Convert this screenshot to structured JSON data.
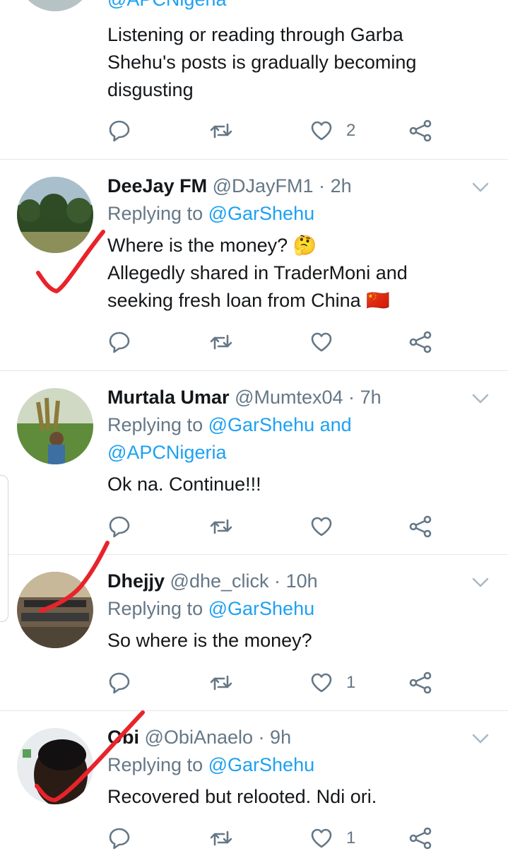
{
  "tweets": [
    {
      "reply_to_links": [
        "@APCNigeria"
      ],
      "text": [
        "Listening or reading through Garba",
        "Shehu's posts is gradually becoming",
        "disgusting"
      ],
      "likes": "2"
    },
    {
      "name": "DeeJay FM",
      "handle": "@DJayFM1",
      "separator": "·",
      "time": "2h",
      "reply_prefix": "Replying to",
      "reply_to": "@GarShehu",
      "text": [
        "Where is the money? 🤔",
        "Allegedly shared in TraderMoni and",
        "seeking fresh loan from China 🇨🇳"
      ],
      "likes": ""
    },
    {
      "name": "Murtala Umar",
      "handle": "@Mumtex04",
      "separator": "·",
      "time": "7h",
      "reply_prefix": "Replying to",
      "reply_to": "@GarShehu",
      "reply_conj": "and",
      "reply_to_2": "@APCNigeria",
      "text": [
        "Ok na. Continue!!!"
      ],
      "likes": ""
    },
    {
      "name": "Dhejjy",
      "handle": "@dhe_click",
      "separator": "·",
      "time": "10h",
      "reply_prefix": "Replying to",
      "reply_to": "@GarShehu",
      "text": [
        "So where is the money?"
      ],
      "likes": "1"
    },
    {
      "name": "Obi",
      "handle": "@ObiAnaelo",
      "separator": "·",
      "time": "9h",
      "reply_prefix": "Replying to",
      "reply_to": "@GarShehu",
      "text": [
        "Recovered but relooted. Ndi ori."
      ],
      "likes": "1"
    }
  ],
  "icons": {
    "reply": "reply-icon",
    "retweet": "retweet-icon",
    "like": "heart-icon",
    "share": "share-icon",
    "menu": "chevron-down-icon"
  },
  "colors": {
    "link": "#1da1f2",
    "secondary_text": "#657786",
    "divider": "#e1e8ed",
    "annotation_mark": "#e8232a"
  }
}
